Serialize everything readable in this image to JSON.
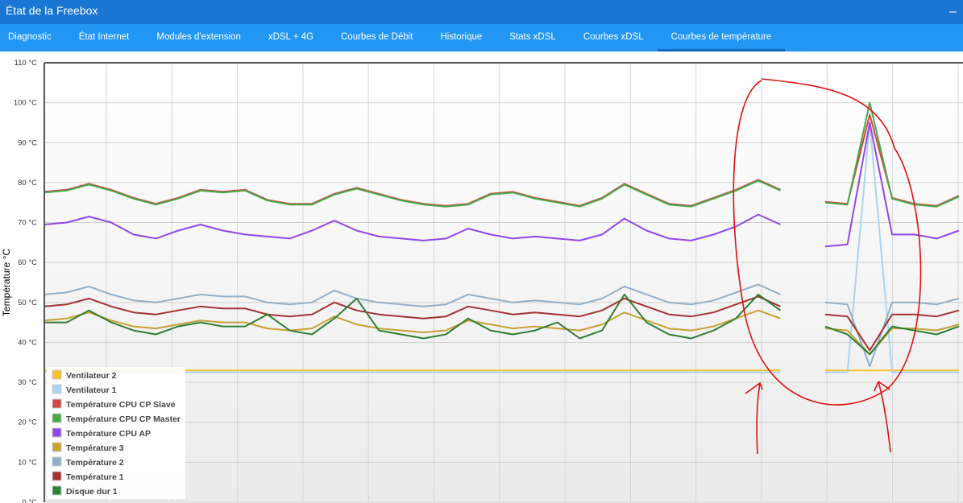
{
  "window": {
    "title": "État de la Freebox",
    "minimize_label": "‒"
  },
  "tabs": [
    {
      "label": "Diagnostic"
    },
    {
      "label": "État Internet"
    },
    {
      "label": "Modules d'extension"
    },
    {
      "label": "xDSL + 4G"
    },
    {
      "label": "Courbes de Débit"
    },
    {
      "label": "Historique"
    },
    {
      "label": "Stats xDSL"
    },
    {
      "label": "Courbes xDSL"
    },
    {
      "label": "Courbes de température",
      "active": true
    }
  ],
  "chart_data": {
    "type": "line",
    "title": "",
    "ylabel": "Température °C",
    "ylim": [
      0,
      110
    ],
    "yticks": [
      "0 °C",
      "10 °C",
      "20 °C",
      "30 °C",
      "40 °C",
      "50 °C",
      "60 °C",
      "70 °C",
      "80 °C",
      "90 °C",
      "100 °C",
      "110 °C"
    ],
    "grid": true,
    "legend_position": "bottom-left",
    "series": [
      {
        "name": "Ventilateur 2",
        "color": "#f2c232",
        "values": [
          33,
          33,
          33,
          33,
          33,
          33,
          33,
          33,
          33,
          33,
          33,
          33,
          33,
          33,
          33,
          33,
          33,
          33,
          33,
          33,
          33,
          33,
          33,
          33,
          33,
          33,
          33,
          33,
          33,
          33,
          33,
          33,
          33,
          33,
          null,
          33,
          33,
          33,
          33,
          33,
          33,
          33
        ]
      },
      {
        "name": "Ventilateur 1",
        "color": "#acd4f2",
        "values": [
          32.5,
          32.5,
          32.5,
          32.5,
          32.5,
          32.5,
          32.5,
          32.5,
          32.5,
          32.5,
          32.5,
          32.5,
          32.5,
          32.5,
          32.5,
          32.5,
          32.5,
          32.5,
          32.5,
          32.5,
          32.5,
          32.5,
          32.5,
          32.5,
          32.5,
          32.5,
          32.5,
          32.5,
          32.5,
          32.5,
          32.5,
          32.5,
          32.5,
          32.5,
          null,
          32.5,
          32.5,
          95,
          32.5,
          32.5,
          32.5,
          32.5
        ]
      },
      {
        "name": "Température CPU CP Slave",
        "color": "#d04848",
        "values": [
          77.7,
          78.2,
          79.7,
          78.2,
          76.2,
          74.7,
          76.2,
          78.2,
          77.7,
          78.2,
          75.7,
          74.7,
          74.7,
          77.2,
          78.7,
          77.2,
          75.7,
          74.7,
          74.2,
          74.7,
          77.2,
          77.7,
          76.2,
          75.2,
          74.2,
          76.2,
          79.7,
          77.2,
          74.7,
          74.2,
          76.2,
          78.2,
          80.7,
          78.2,
          null,
          75.2,
          74.7,
          97,
          76.2,
          74.7,
          74.2,
          76.7
        ]
      },
      {
        "name": "Température CPU CP Master",
        "color": "#48a848",
        "values": [
          77.5,
          78,
          79.5,
          78,
          76,
          74.5,
          76,
          78,
          77.5,
          78,
          75.5,
          74.5,
          74.5,
          77,
          78.5,
          77,
          75.5,
          74.5,
          74,
          74.5,
          77,
          77.5,
          76,
          75,
          74,
          76,
          79.5,
          77,
          74.5,
          74,
          76,
          78,
          80.5,
          78,
          null,
          75,
          74.5,
          100,
          76,
          74.5,
          74,
          76.5
        ]
      },
      {
        "name": "Température CPU AP",
        "color": "#9447e6",
        "values": [
          69.5,
          70,
          71.5,
          70,
          67,
          66,
          68,
          69.5,
          68,
          67,
          66.5,
          66,
          68,
          70.5,
          68,
          66.5,
          66,
          65.5,
          66,
          68.5,
          67,
          66,
          66.5,
          66,
          65.5,
          67,
          71,
          68,
          66,
          65.5,
          67,
          69,
          72,
          69.5,
          null,
          64,
          64.5,
          95,
          67,
          67,
          66,
          68
        ]
      },
      {
        "name": "Température 3",
        "color": "#c9a035",
        "values": [
          45.5,
          46,
          47.5,
          45.5,
          44,
          43.5,
          44.5,
          45.5,
          45,
          45,
          43.5,
          43,
          43.5,
          46.5,
          44.5,
          43.5,
          43,
          42.5,
          43,
          45.5,
          44.5,
          43.5,
          44,
          43.5,
          43,
          44.5,
          47.5,
          45.5,
          43.5,
          43,
          44,
          46,
          48,
          46,
          null,
          43.5,
          43,
          37,
          43.5,
          43.5,
          43,
          44.5
        ]
      },
      {
        "name": "Température 2",
        "color": "#90b0ca",
        "values": [
          52,
          52.5,
          54,
          52,
          50.5,
          50,
          51,
          52,
          51.5,
          51.5,
          50,
          49.5,
          50,
          53,
          51,
          50,
          49.5,
          49,
          49.5,
          52,
          51,
          50,
          50.5,
          50,
          49.5,
          51,
          54,
          52,
          50,
          49.5,
          50.5,
          52.5,
          54.5,
          52,
          null,
          50,
          49.5,
          34,
          50,
          50,
          49.5,
          51
        ]
      },
      {
        "name": "Température 1",
        "color": "#a33232",
        "values": [
          49,
          49.5,
          51,
          49,
          47.5,
          47,
          48,
          49,
          48.5,
          48.5,
          47,
          46.5,
          47,
          50,
          48,
          47,
          46.5,
          46,
          46.5,
          49,
          48,
          47,
          47.5,
          47,
          46.5,
          48,
          51,
          49,
          47,
          46.5,
          47.5,
          49.5,
          51.5,
          49,
          null,
          47,
          46.5,
          38,
          47,
          47,
          46.5,
          48
        ]
      },
      {
        "name": "Disque dur 1",
        "color": "#2f7f34",
        "values": [
          45,
          45,
          48,
          45,
          43,
          42,
          44,
          45,
          44,
          44,
          47,
          43,
          42,
          46,
          51,
          43,
          42,
          41,
          42,
          46,
          43,
          42,
          43,
          45,
          41,
          43,
          52,
          45,
          42,
          41,
          43,
          46,
          52,
          48,
          null,
          44,
          42,
          37,
          44,
          43,
          42,
          44
        ]
      }
    ]
  }
}
